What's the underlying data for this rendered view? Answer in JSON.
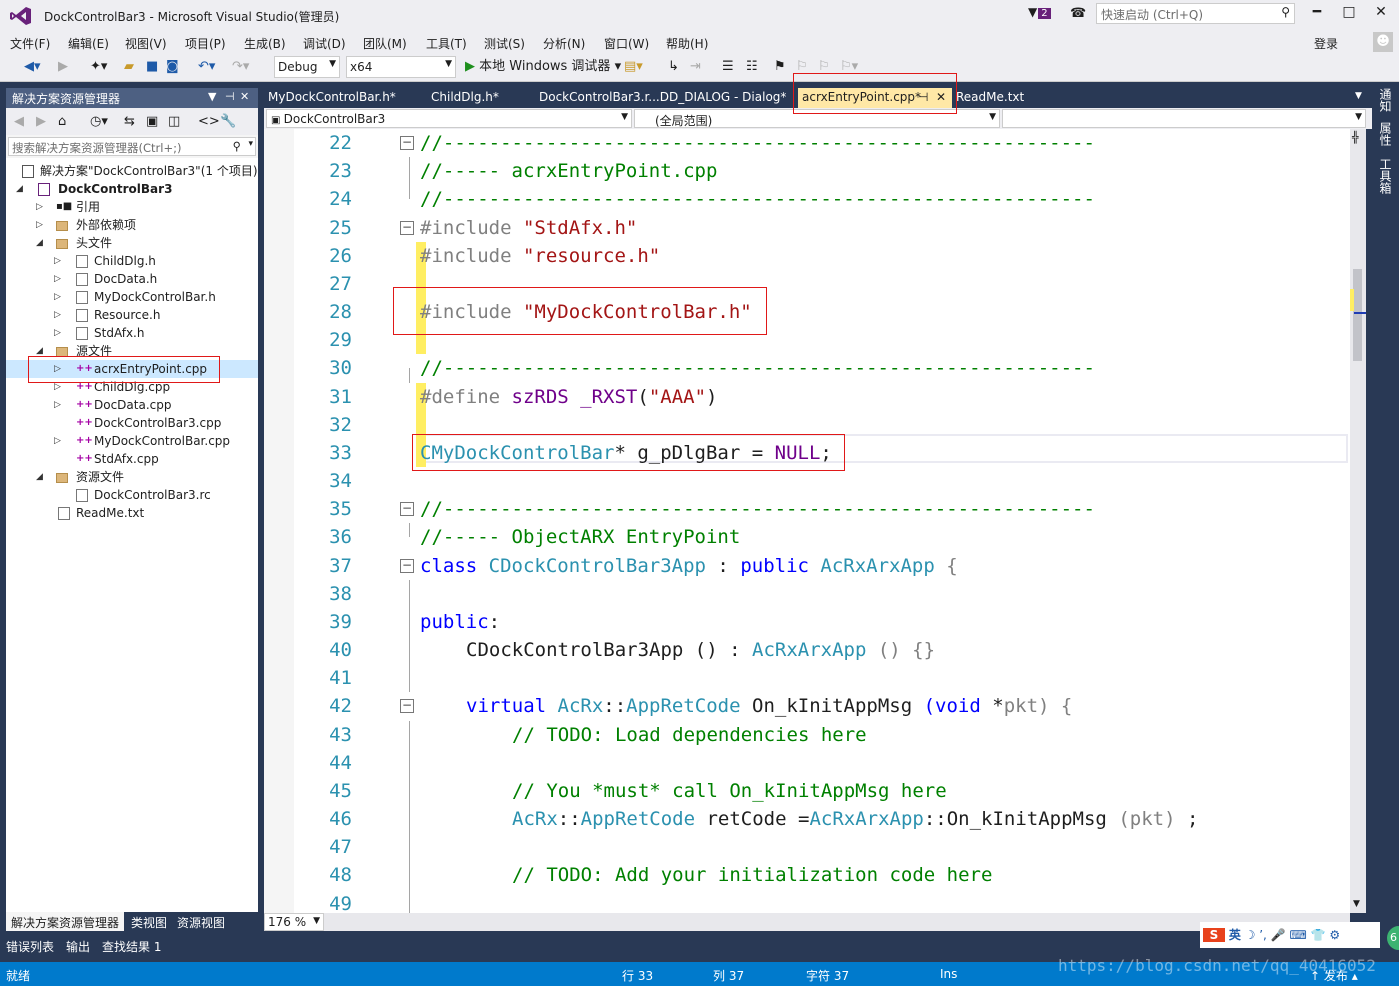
{
  "window": {
    "title": "DockControlBar3 - Microsoft Visual Studio(管理员)",
    "notify_count": "2",
    "quick_launch_placeholder": "快速启动 (Ctrl+Q)",
    "minimize": "━",
    "maximize": "□",
    "close": "✕"
  },
  "menu": {
    "items": [
      "文件(F)",
      "编辑(E)",
      "视图(V)",
      "项目(P)",
      "生成(B)",
      "调试(D)",
      "团队(M)",
      "工具(T)",
      "测试(S)",
      "分析(N)",
      "窗口(W)",
      "帮助(H)"
    ],
    "login": "登录"
  },
  "toolbar": {
    "config": "Debug",
    "platform": "x64",
    "debugger": "本地 Windows 调试器"
  },
  "solution_explorer": {
    "title": "解决方案资源管理器",
    "search_placeholder": "搜索解决方案资源管理器(Ctrl+;)",
    "items": [
      {
        "label": "解决方案\"DockControlBar3\"(1 个项目)"
      },
      {
        "label": "DockControlBar3"
      },
      {
        "label": "引用"
      },
      {
        "label": "外部依赖项"
      },
      {
        "label": "头文件"
      },
      {
        "label": "ChildDlg.h"
      },
      {
        "label": "DocData.h"
      },
      {
        "label": "MyDockControlBar.h"
      },
      {
        "label": "Resource.h"
      },
      {
        "label": "StdAfx.h"
      },
      {
        "label": "源文件"
      },
      {
        "label": "acrxEntryPoint.cpp"
      },
      {
        "label": "ChildDlg.cpp"
      },
      {
        "label": "DocData.cpp"
      },
      {
        "label": "DockControlBar3.cpp"
      },
      {
        "label": "MyDockControlBar.cpp"
      },
      {
        "label": "StdAfx.cpp"
      },
      {
        "label": "资源文件"
      },
      {
        "label": "DockControlBar3.rc"
      },
      {
        "label": "ReadMe.txt"
      }
    ],
    "bottom_tabs": [
      "解决方案资源管理器",
      "类视图",
      "资源视图"
    ]
  },
  "editor": {
    "tabs": [
      "MyDockControlBar.h*",
      "ChildDlg.h*",
      "DockControlBar3.r...DD_DIALOG - Dialog*",
      "acrxEntryPoint.cpp*",
      "ReadMe.txt"
    ],
    "project_combo": "DockControlBar3",
    "scope_combo": "(全局范围)",
    "zoom": "176 %",
    "line_numbers": [
      "22",
      "23",
      "24",
      "25",
      "26",
      "27",
      "28",
      "29",
      "30",
      "31",
      "32",
      "33",
      "34",
      "35",
      "36",
      "37",
      "38",
      "39",
      "40",
      "41",
      "42",
      "43",
      "44",
      "45",
      "46",
      "47",
      "48",
      "49"
    ],
    "code": {
      "l22": "//---------------------------------------------------------",
      "l23": "//----- acrxEntryPoint.cpp",
      "l24": "//---------------------------------------------------------",
      "l25a": "#include ",
      "l25b": "\"StdAfx.h\"",
      "l26a": "#include ",
      "l26b": "\"resource.h\"",
      "l28a": "#include ",
      "l28b": "\"MyDockControlBar.h\"",
      "l30": "//---------------------------------------------------------",
      "l31a": "#define ",
      "l31b": "szRDS ",
      "l31c": "_RXST",
      "l31d": "(",
      "l31e": "\"AAA\"",
      "l31f": ")",
      "l33a": "CMyDockControlBar",
      "l33b": "* g_pDlgBar = ",
      "l33c": "NULL",
      ";": ";",
      "l35": "//---------------------------------------------------------",
      "l36": "//----- ObjectARX EntryPoint",
      "l37a": "class ",
      "l37b": "CDockControlBar3App",
      " : ": " : ",
      "l37c": "public ",
      "l37d": "AcRxArxApp",
      " {": " {",
      "l39a": "public",
      ":": ":",
      "l40a": "CDockControlBar3App ",
      "l40b": "()",
      "l40c": "AcRxArxApp",
      " () {}": " () {}",
      "l42a": "virtual ",
      "l42b": "AcRx",
      "::": "::",
      "l42c": "AppRetCode",
      " On_kInitAppMsg ": " On_kInitAppMsg ",
      "l42d": "(void ",
      "*": "*",
      "l42e": "pkt",
      ") {": ") {",
      "l43": "// TODO: Load dependencies here",
      "l45": "// You *must* call On_kInitAppMsg here",
      "l46a": "AcRx",
      "l46b": "::",
      "l46c": "AppRetCode",
      " retCode =": " retCode =",
      "l46d": "AcRxArxApp",
      "l46e": "::",
      "l46f": "On_kInitAppMsg ",
      "l46g": "(pkt)",
      " ;": " ;",
      "l48": "// TODO: Add your initialization code here",
      "l49": ""
    }
  },
  "right_strip": [
    "通知",
    "属性",
    "工具箱"
  ],
  "bottom_panel": {
    "tabs": [
      "错误列表",
      "输出",
      "查找结果 1"
    ]
  },
  "status": {
    "ready": "就绪",
    "row": "行 33",
    "col": "列 37",
    "char": "字符 37",
    "ins": "Ins",
    "publish": "发布"
  },
  "ime": {
    "logo": "S",
    "lang": "英",
    "items": "☽ ’, 🎤 ⌨ 👕 ⚙"
  },
  "watermark": "https://blog.csdn.net/qq_40416052",
  "green_badge": "6"
}
